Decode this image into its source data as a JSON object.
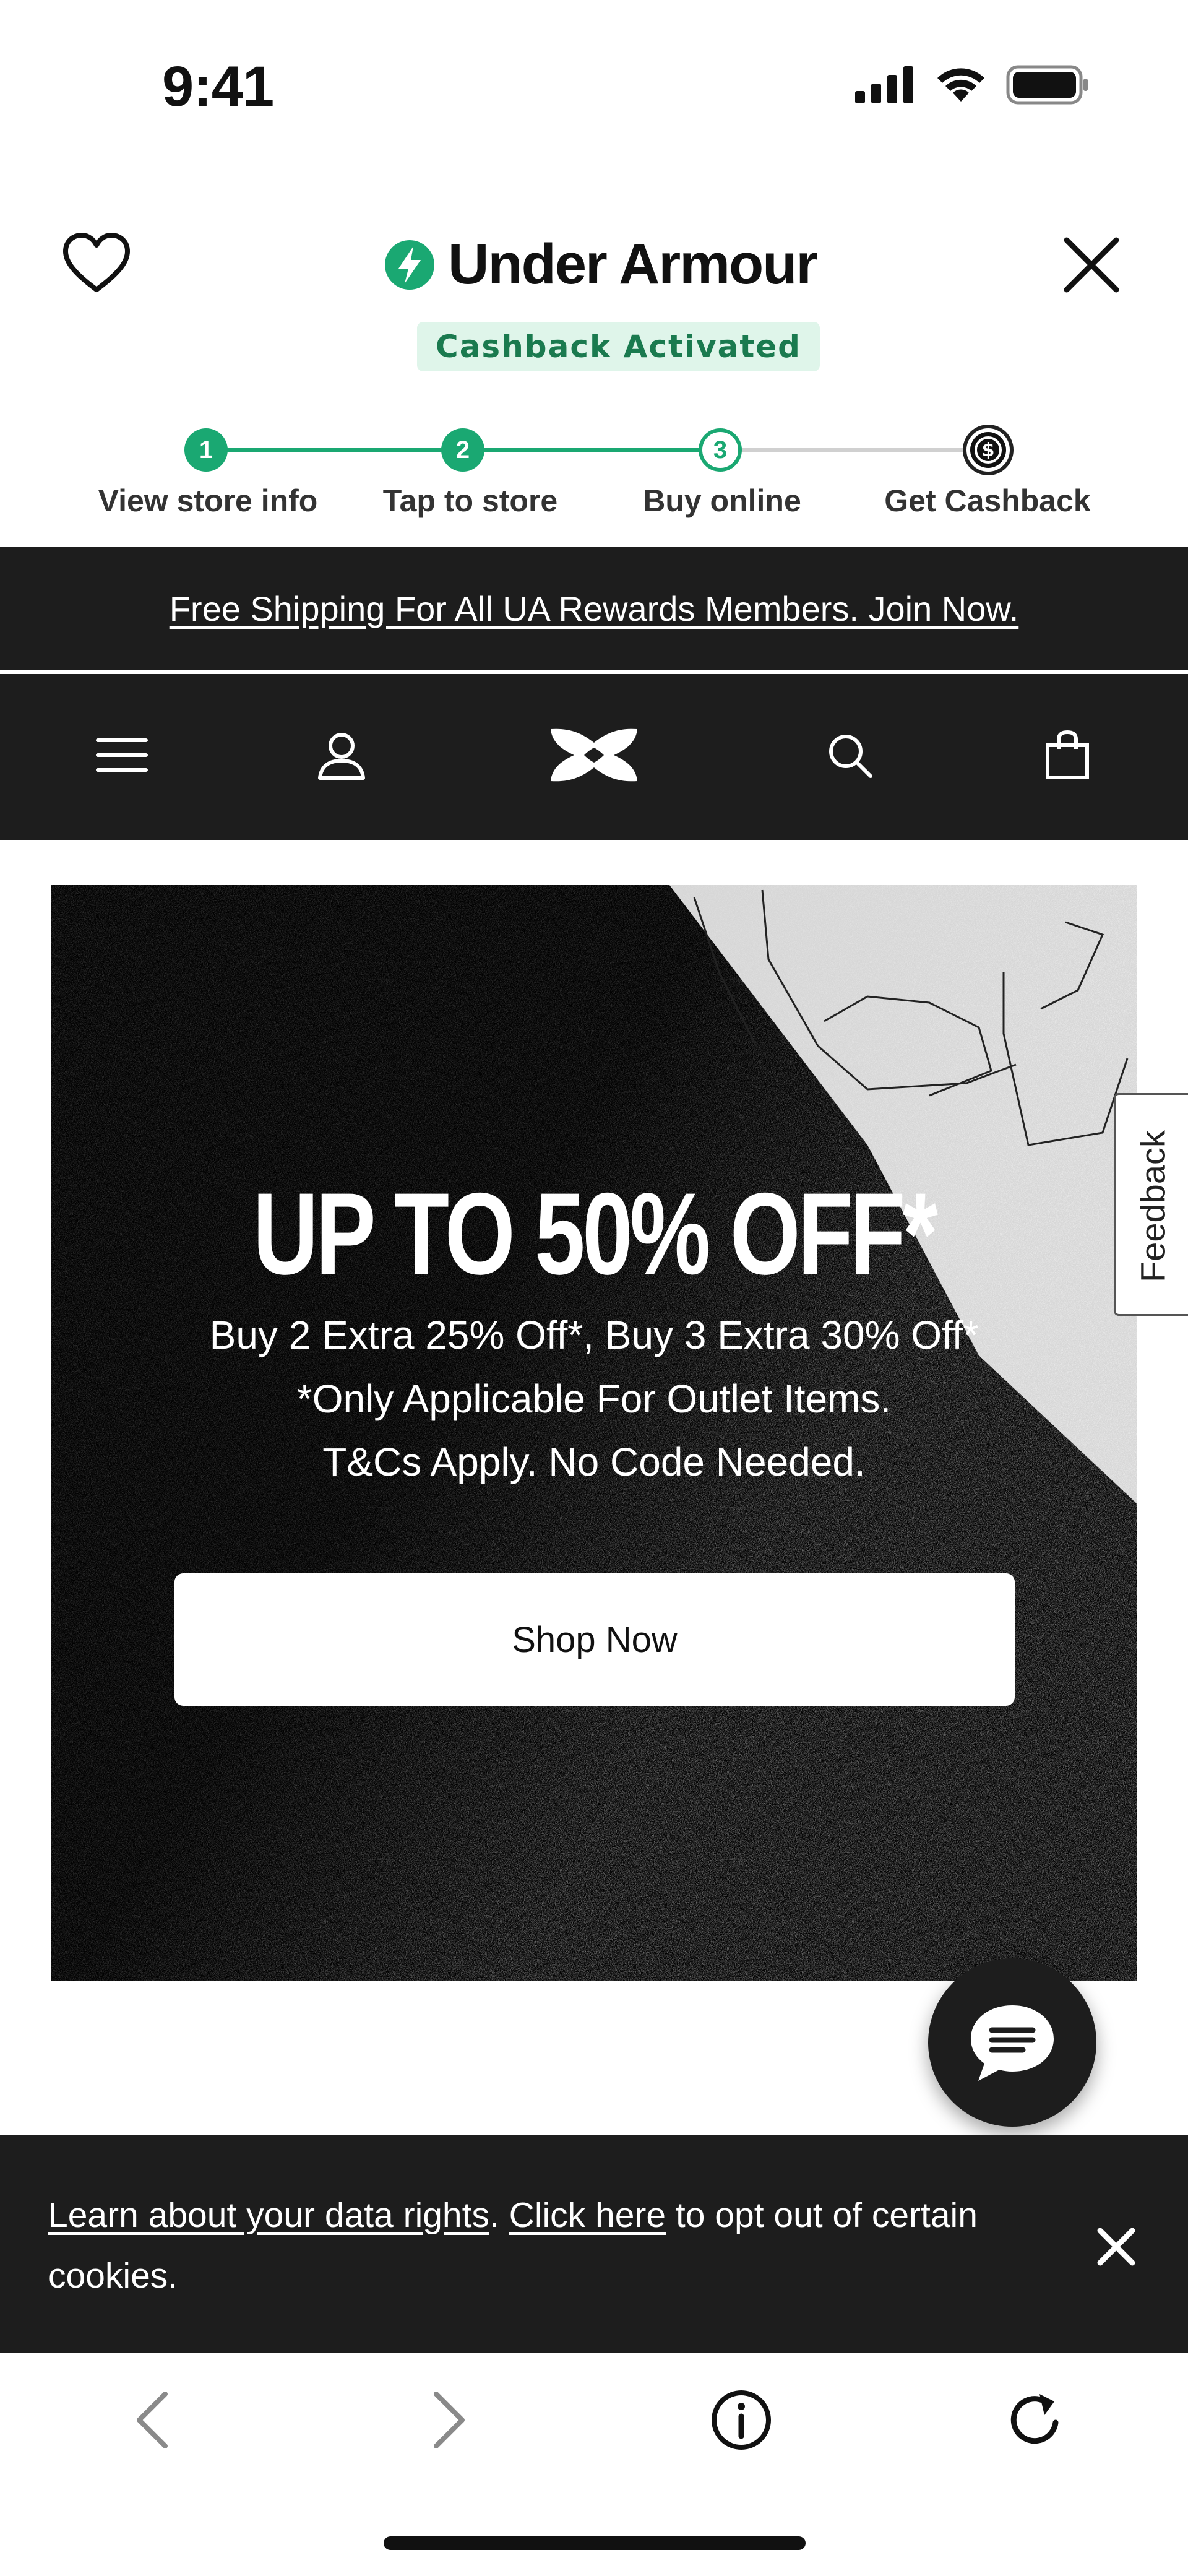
{
  "status_bar": {
    "time": "9:41",
    "icons": [
      "signal-icon",
      "wifi-icon",
      "battery-icon"
    ]
  },
  "cashback_header": {
    "brand_name": "Under Armour",
    "badge": "Cashback Activated",
    "accent_color": "#1aa872",
    "steps": [
      {
        "number": "1",
        "label": "View store info",
        "state": "done"
      },
      {
        "number": "2",
        "label": "Tap to store",
        "state": "done"
      },
      {
        "number": "3",
        "label": "Buy online",
        "state": "current"
      },
      {
        "number": "",
        "label": "Get Cashback",
        "state": "pending"
      }
    ]
  },
  "promo_bar": {
    "text": "Free Shipping For All UA Rewards Members. Join Now."
  },
  "nav": {
    "items": [
      "menu-icon",
      "account-icon",
      "ua-logo-icon",
      "search-icon",
      "bag-icon"
    ]
  },
  "hero": {
    "title": "UP TO 50% OFF*",
    "line1": "Buy 2 Extra 25% Off*, Buy 3 Extra 30% Off*",
    "line2": "*Only Applicable For Outlet Items.",
    "line3": "T&Cs Apply. No Code Needed.",
    "cta": "Shop Now"
  },
  "feedback": {
    "label": "Feedback"
  },
  "cookie_bar": {
    "link1": "Learn about your data rights",
    "sep": ".",
    "link2": "Click here",
    "rest": " to opt out of certain cookies."
  },
  "browser_toolbar": {
    "buttons": [
      "back-icon",
      "forward-icon",
      "info-icon",
      "reload-icon"
    ]
  }
}
